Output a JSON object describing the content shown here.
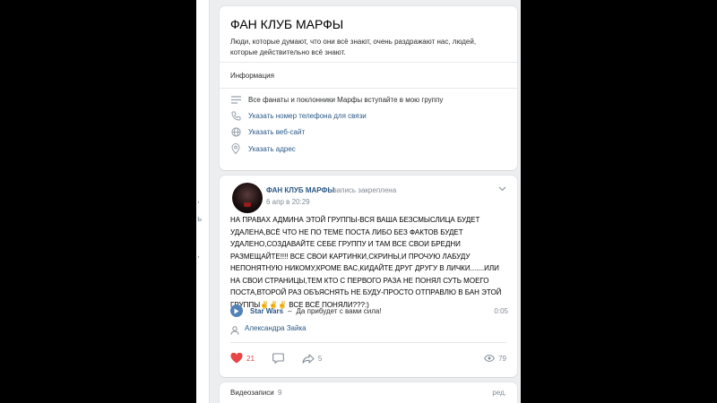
{
  "group": {
    "title": "ФАН КЛУБ МАРФЫ",
    "status": "Люди, которые думают, что они всё знают, очень раздражают нас, людей, которые действительно всё знают.",
    "info_label": "Информация",
    "description": "Все фанаты и поклонники Марфы вступайте в мою группу",
    "phone_link": "Указать номер телефона для связи",
    "website_link": "Указать веб-сайт",
    "address_link": "Указать адрес"
  },
  "post": {
    "author": "ФАН КЛУБ МАРФЫ",
    "pinned_label": "запись закреплена",
    "date": "6 апр в 20:29",
    "text": "НА ПРАВАХ АДМИНА ЭТОЙ ГРУППЫ-ВСЯ ВАША БЕЗСМЫСЛИЦА БУДЕТ УДАЛЕНА,ВСЁ ЧТО НЕ ПО ТЕМЕ ПОСТА ЛИБО БЕЗ ФАКТОВ БУДЕТ УДАЛЕНО,СОЗДАВАЙТЕ СЕБЕ ГРУППУ И ТАМ ВСЕ СВОИ БРЕДНИ РАЗМЕЩАЙТЕ!!!! ВСЕ СВОИ КАРТИНКИ,СКРИНЫ,И ПРОЧУЮ ЛАБУДУ НЕПОНЯТНУЮ НИКОМУ,КРОМЕ ВАС,КИДАЙТЕ ДРУГ ДРУГУ В ЛИЧКИ.......ИЛИ НА СВОИ СТРАНИЦЫ,ТЕМ КТО С ПЕРВОГО РАЗА НЕ ПОНЯЛ СУТЬ МОЕГО ПОСТА,ВТОРОЙ РАЗ ОБЪЯСНЯТЬ НЕ БУДУ-ПРОСТО ОТПРАВЛЮ В БАН ЭТОЙ ГРУППЫ✌✌✌ ВСЕ ВСЁ ПОНЯЛИ???:)",
    "audio": {
      "artist": "Star Wars",
      "separator": "–",
      "title": "Да прибудет с вами сила!",
      "duration": "0:05"
    },
    "signer": "Александра Зайка",
    "likes": "21",
    "shares": "5",
    "views": "79"
  },
  "videos": {
    "title": "Видеозаписи",
    "count": "9",
    "edit": "ред."
  },
  "sidebar_fragments": [
    ",",
    "ь",
    ","
  ],
  "colors": {
    "link": "#2a5885",
    "like": "#e64646",
    "play": "#5181b8",
    "muted": "#818c99"
  }
}
